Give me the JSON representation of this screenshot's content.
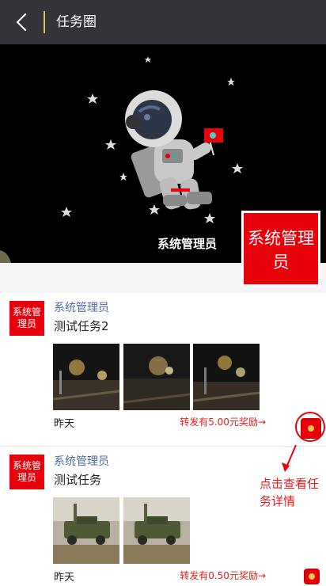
{
  "header": {
    "title": "任务圈",
    "back_icon": "chevron-left-icon"
  },
  "banner": {
    "user_name": "系统管理员",
    "avatar_text": "系统管理员"
  },
  "posts": [
    {
      "avatar_text": "系统管理员",
      "author": "系统管理员",
      "title": "测试任务2",
      "time": "昨天",
      "reward": "转发有5.00元奖励→"
    },
    {
      "avatar_text": "系统管理员",
      "author": "系统管理员",
      "title": "测试任务",
      "time": "昨天",
      "reward": "转发有0.50元奖励→"
    }
  ],
  "annotation": {
    "text": "点击查看任务详情"
  },
  "colors": {
    "header_bg": "#333338",
    "accent_red": "#e8000b",
    "author_blue": "#4f6aa0",
    "reward_red": "#e0201c"
  }
}
